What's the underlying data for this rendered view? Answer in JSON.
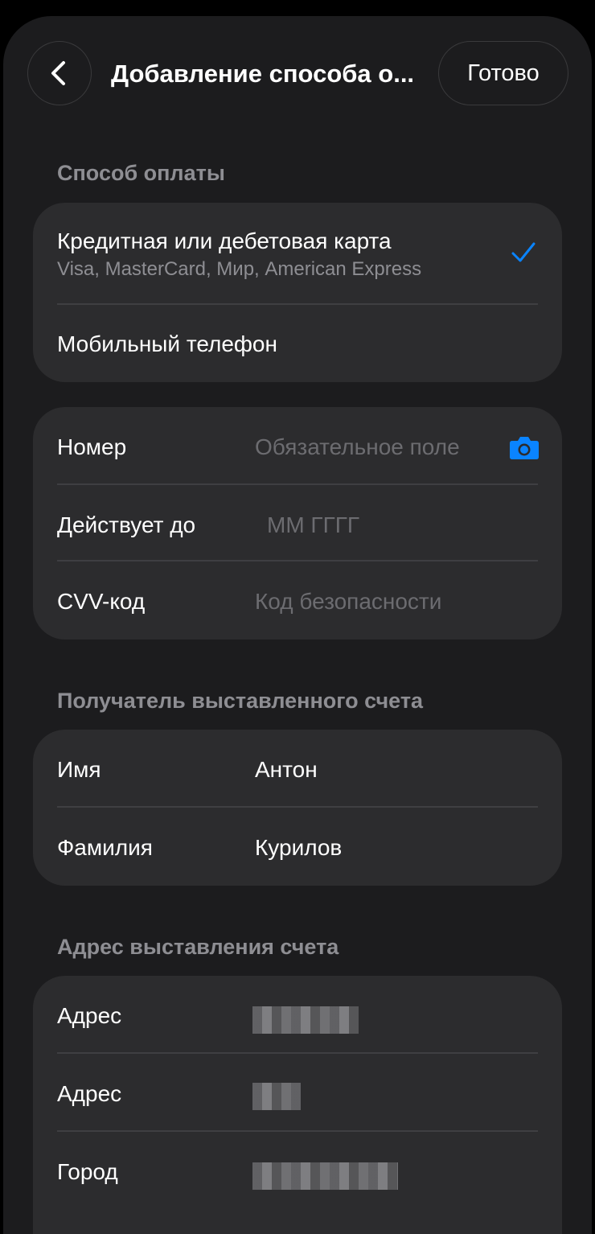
{
  "header": {
    "title": "Добавление способа о...",
    "done_label": "Готово"
  },
  "payment": {
    "section_label": "Способ оплаты",
    "options": [
      {
        "label": "Кредитная или дебетовая карта",
        "sub": "Visa, MasterCard, Мир, American Express",
        "selected": true
      },
      {
        "label": "Мобильный телефон",
        "selected": false
      }
    ]
  },
  "card": {
    "number_label": "Номер",
    "number_placeholder": "Обязательное поле",
    "expiry_label": "Действует до",
    "expiry_placeholder": "ММ ГГГГ",
    "cvv_label": "CVV-код",
    "cvv_placeholder": "Код безопасности"
  },
  "recipient": {
    "section_label": "Получатель выставленного счета",
    "first_name_label": "Имя",
    "first_name_value": "Антон",
    "last_name_label": "Фамилия",
    "last_name_value": "Курилов"
  },
  "address": {
    "section_label": "Адрес выставления счета",
    "rows": [
      {
        "label": "Адрес"
      },
      {
        "label": "Адрес"
      },
      {
        "label": "Город"
      }
    ]
  },
  "colors": {
    "accent": "#0a84ff",
    "background": "#1c1c1e",
    "card": "#2c2c2e"
  },
  "icons": {
    "back": "chevron-left-icon",
    "check": "checkmark-icon",
    "camera": "camera-icon"
  }
}
